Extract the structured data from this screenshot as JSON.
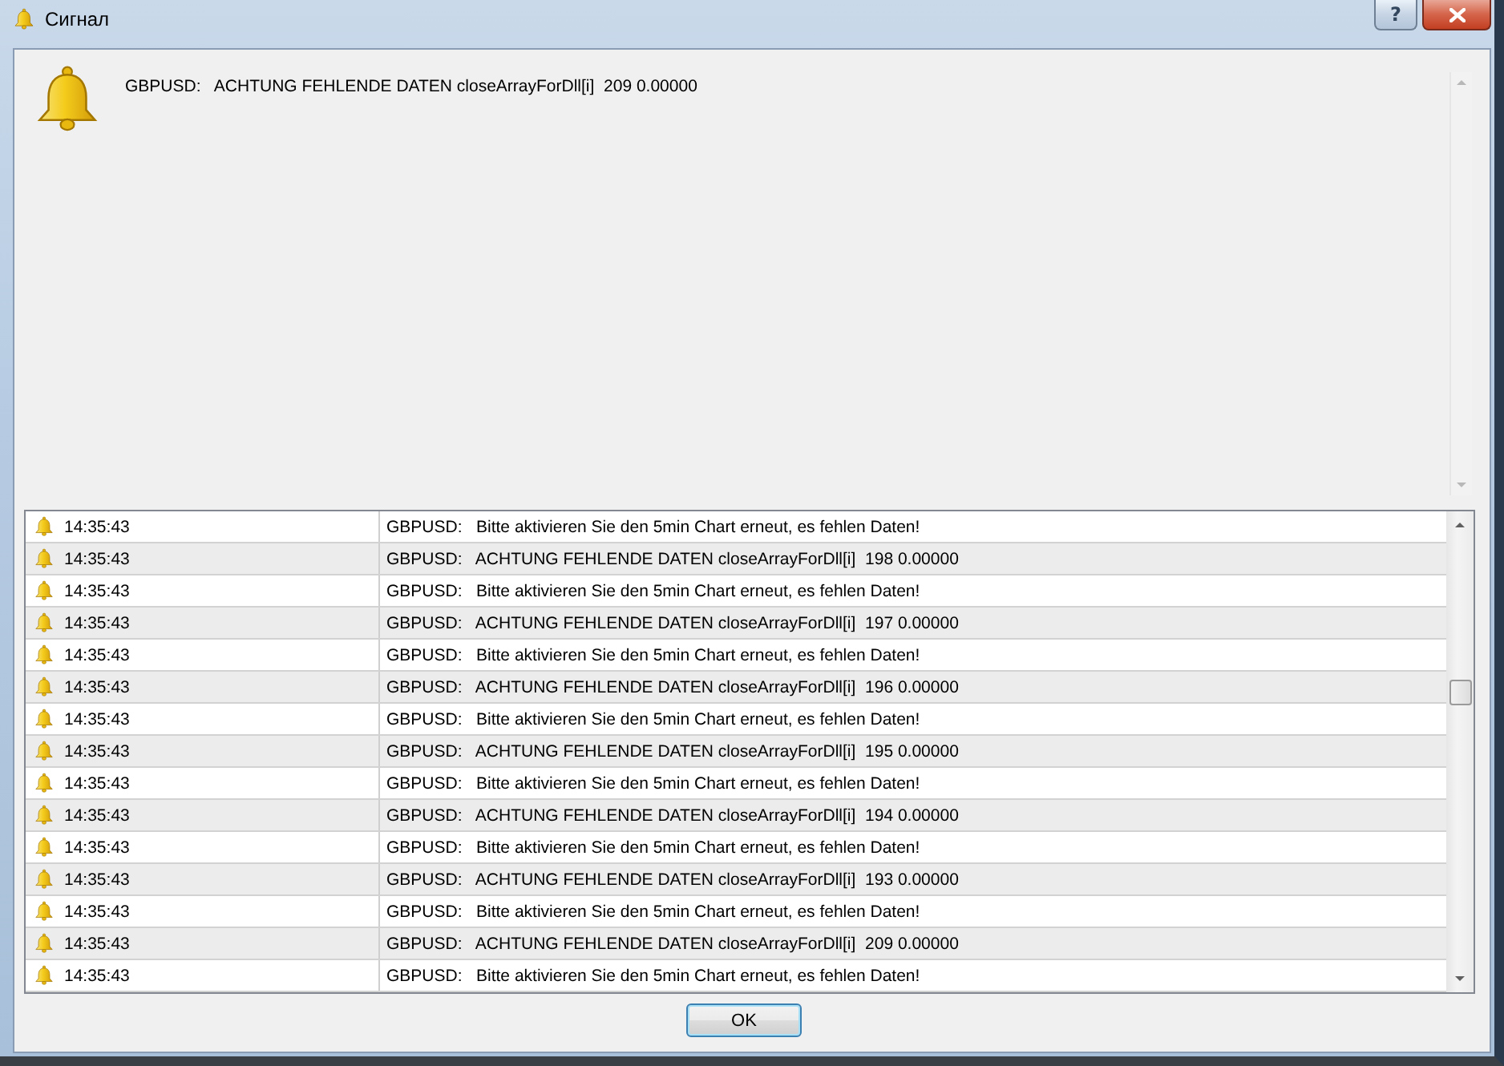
{
  "window": {
    "title": "Сигнал",
    "help_button": "?"
  },
  "alert": {
    "message": "GBPUSD:   ACHTUNG FEHLENDE DATEN closeArrayForDll[i]  209 0.00000"
  },
  "log": {
    "rows": [
      {
        "time": "14:35:43",
        "message": "GBPUSD:   Bitte aktivieren Sie den 5min Chart erneut, es fehlen Daten!"
      },
      {
        "time": "14:35:43",
        "message": "GBPUSD:   ACHTUNG FEHLENDE DATEN closeArrayForDll[i]  198 0.00000"
      },
      {
        "time": "14:35:43",
        "message": "GBPUSD:   Bitte aktivieren Sie den 5min Chart erneut, es fehlen Daten!"
      },
      {
        "time": "14:35:43",
        "message": "GBPUSD:   ACHTUNG FEHLENDE DATEN closeArrayForDll[i]  197 0.00000"
      },
      {
        "time": "14:35:43",
        "message": "GBPUSD:   Bitte aktivieren Sie den 5min Chart erneut, es fehlen Daten!"
      },
      {
        "time": "14:35:43",
        "message": "GBPUSD:   ACHTUNG FEHLENDE DATEN closeArrayForDll[i]  196 0.00000"
      },
      {
        "time": "14:35:43",
        "message": "GBPUSD:   Bitte aktivieren Sie den 5min Chart erneut, es fehlen Daten!"
      },
      {
        "time": "14:35:43",
        "message": "GBPUSD:   ACHTUNG FEHLENDE DATEN closeArrayForDll[i]  195 0.00000"
      },
      {
        "time": "14:35:43",
        "message": "GBPUSD:   Bitte aktivieren Sie den 5min Chart erneut, es fehlen Daten!"
      },
      {
        "time": "14:35:43",
        "message": "GBPUSD:   ACHTUNG FEHLENDE DATEN closeArrayForDll[i]  194 0.00000"
      },
      {
        "time": "14:35:43",
        "message": "GBPUSD:   Bitte aktivieren Sie den 5min Chart erneut, es fehlen Daten!"
      },
      {
        "time": "14:35:43",
        "message": "GBPUSD:   ACHTUNG FEHLENDE DATEN closeArrayForDll[i]  193 0.00000"
      },
      {
        "time": "14:35:43",
        "message": "GBPUSD:   Bitte aktivieren Sie den 5min Chart erneut, es fehlen Daten!"
      },
      {
        "time": "14:35:43",
        "message": "GBPUSD:   ACHTUNG FEHLENDE DATEN closeArrayForDll[i]  209 0.00000"
      },
      {
        "time": "14:35:43",
        "message": "GBPUSD:   Bitte aktivieren Sie den 5min Chart erneut, es fehlen Daten!"
      }
    ]
  },
  "ok_button": "OK"
}
